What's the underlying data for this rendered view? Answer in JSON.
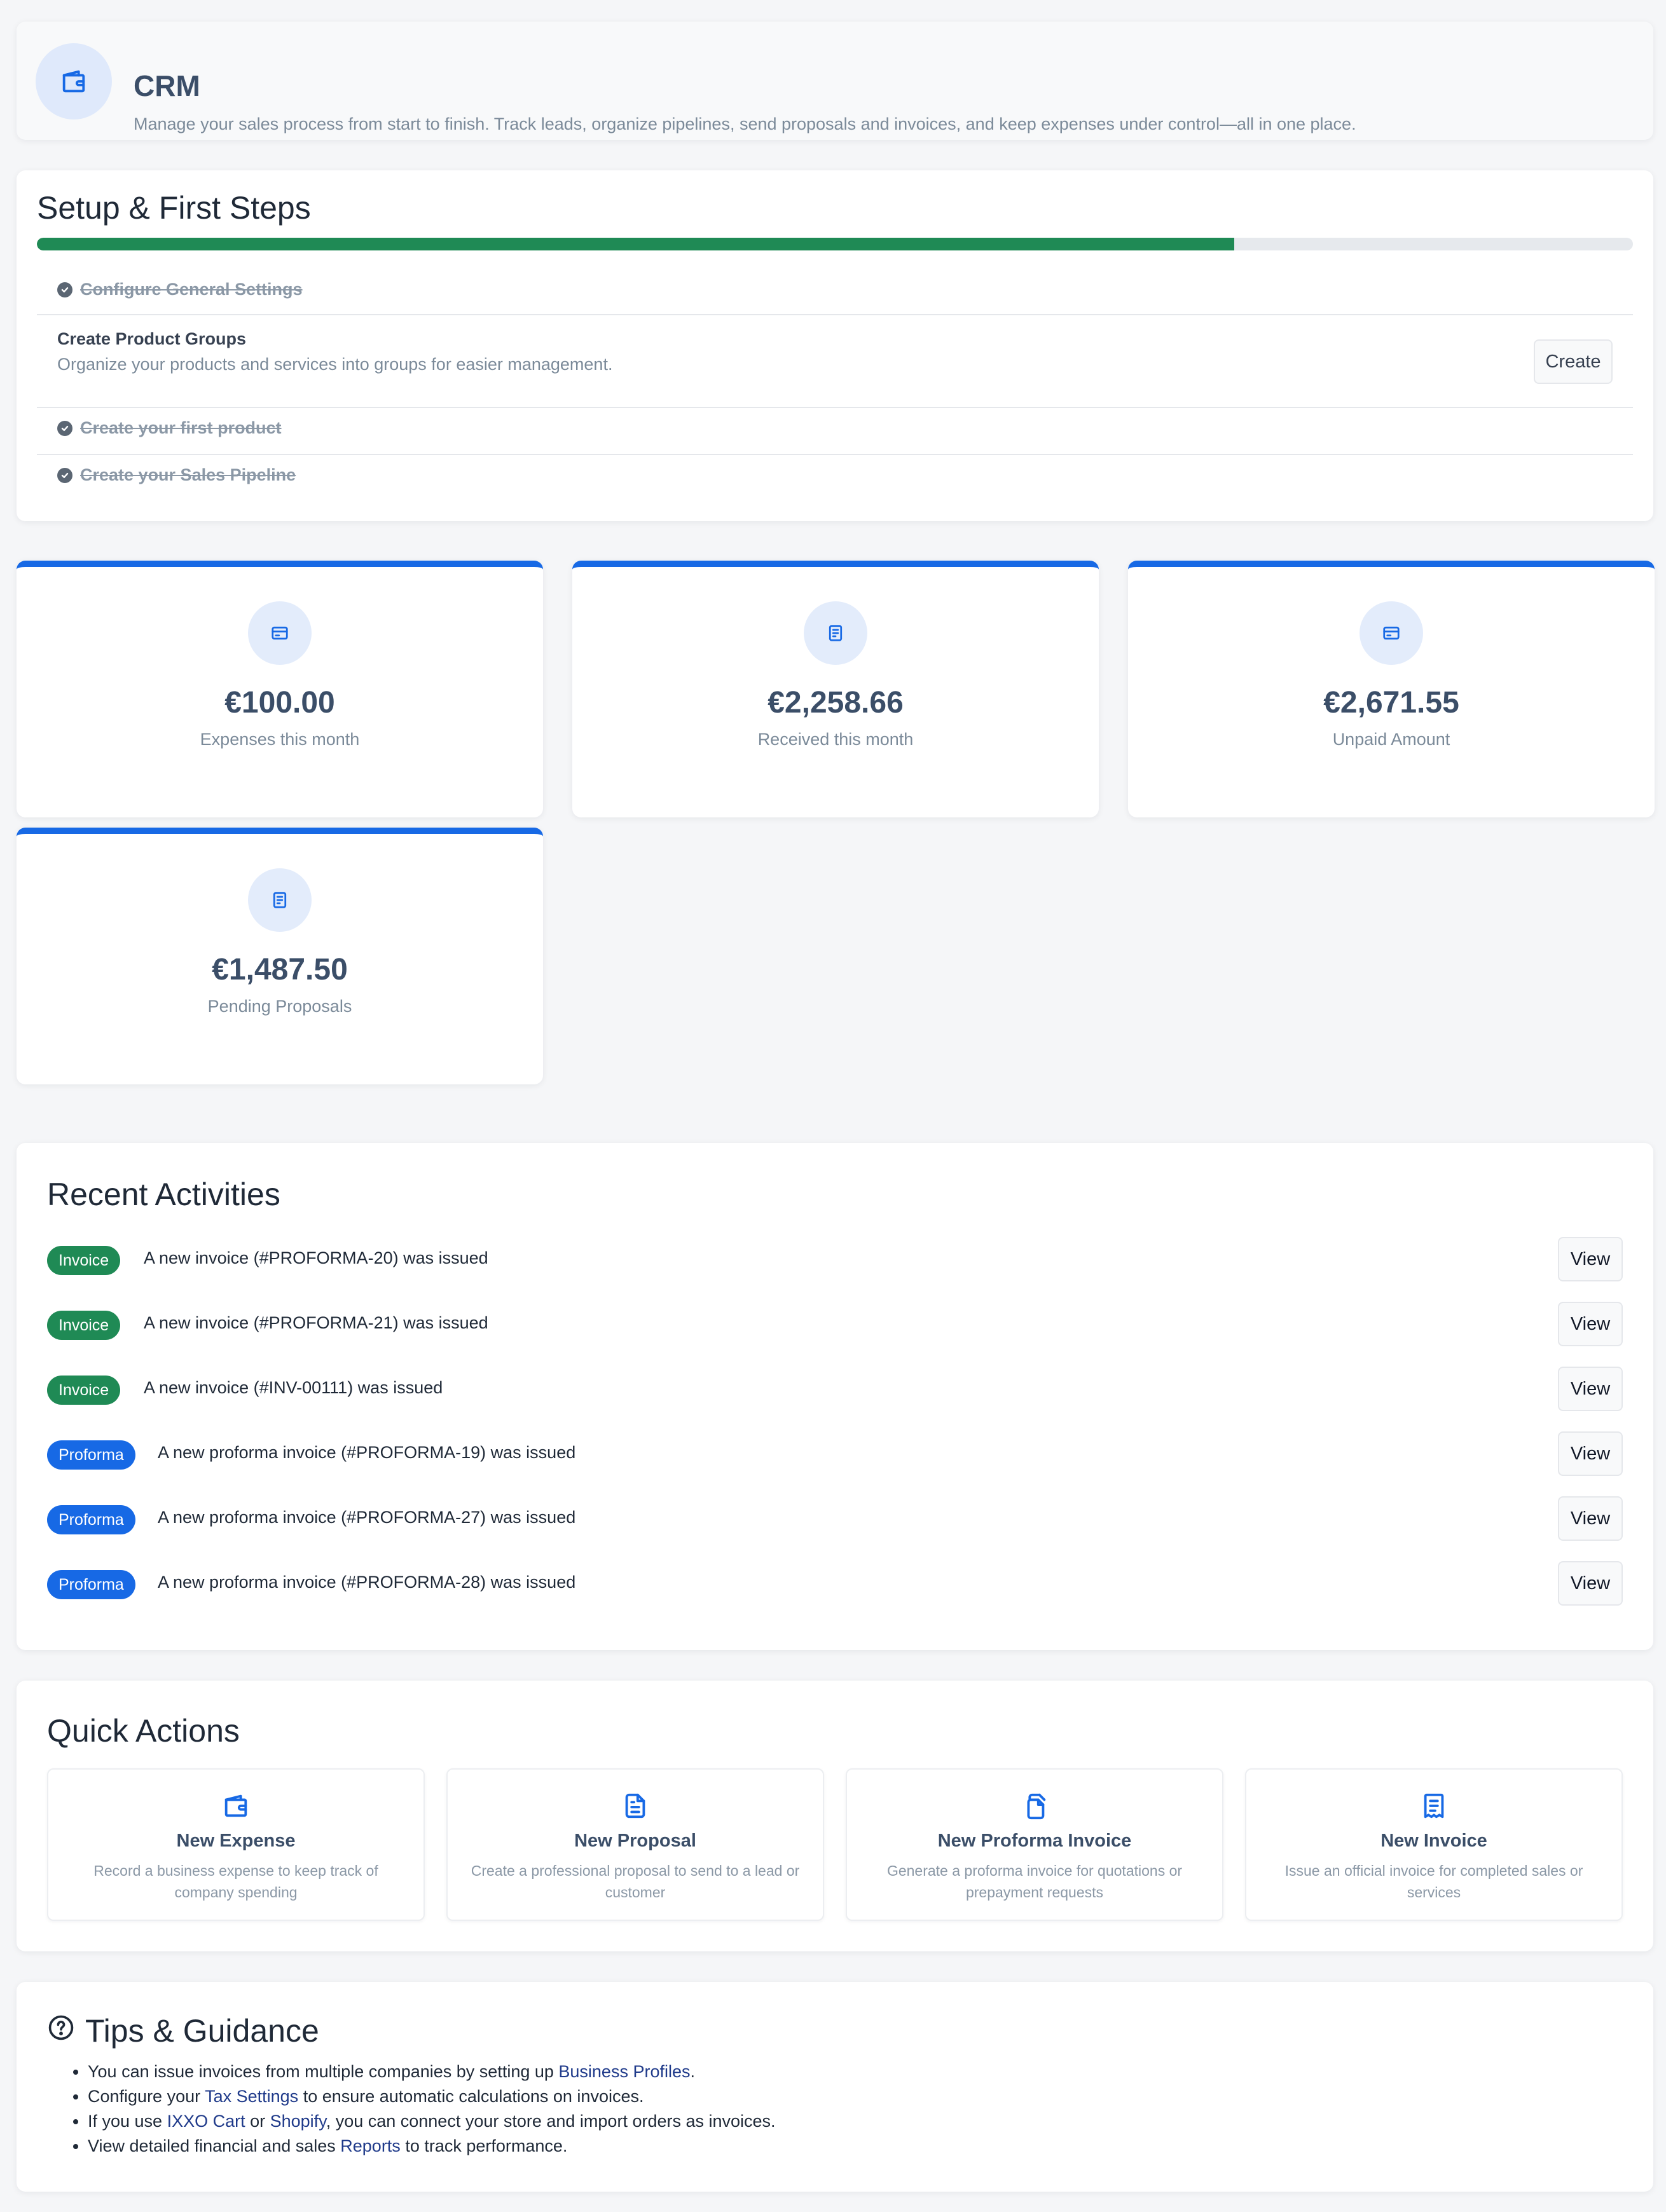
{
  "header": {
    "title": "CRM",
    "subtitle": "Manage your sales process from start to finish. Track leads, organize pipelines, send proposals and invoices, and keep expenses under control—all in one place.",
    "icon": "wallet-icon"
  },
  "setup": {
    "title": "Setup & First Steps",
    "progress": 0.75,
    "steps": [
      {
        "label": "Configure General Settings",
        "done": true
      },
      {
        "label": "Create Product Groups",
        "description": "Organize your products and services into groups for easier management.",
        "done": false,
        "action_label": "Create"
      },
      {
        "label": "Create your first product",
        "done": true
      },
      {
        "label": "Create your Sales Pipeline",
        "done": true
      }
    ]
  },
  "stats": [
    {
      "value": "€100.00",
      "label": "Expenses this month",
      "icon": "credit-card-icon"
    },
    {
      "value": "€2,258.66",
      "label": "Received this month",
      "icon": "document-icon"
    },
    {
      "value": "€2,671.55",
      "label": "Unpaid Amount",
      "icon": "credit-card-icon"
    },
    {
      "value": "€1,487.50",
      "label": "Pending Proposals",
      "icon": "document-icon"
    }
  ],
  "recent": {
    "title": "Recent Activities",
    "view_label": "View",
    "items": [
      {
        "type": "Invoice",
        "text": "A new invoice (#PROFORMA-20) was issued"
      },
      {
        "type": "Invoice",
        "text": "A new invoice (#PROFORMA-21) was issued"
      },
      {
        "type": "Invoice",
        "text": "A new invoice (#INV-00111) was issued"
      },
      {
        "type": "Proforma",
        "text": "A new proforma invoice (#PROFORMA-19) was issued"
      },
      {
        "type": "Proforma",
        "text": "A new proforma invoice (#PROFORMA-27) was issued"
      },
      {
        "type": "Proforma",
        "text": "A new proforma invoice (#PROFORMA-28) was issued"
      }
    ]
  },
  "quick_actions": {
    "title": "Quick Actions",
    "items": [
      {
        "title": "New Expense",
        "description": "Record a business expense to keep track of company spending",
        "icon": "wallet-icon"
      },
      {
        "title": "New Proposal",
        "description": "Create a professional proposal to send to a lead or customer",
        "icon": "file-text-icon"
      },
      {
        "title": "New Proforma Invoice",
        "description": "Generate a proforma invoice for quotations or prepayment requests",
        "icon": "copy-files-icon"
      },
      {
        "title": "New Invoice",
        "description": "Issue an official invoice for completed sales or services",
        "icon": "receipt-icon"
      }
    ]
  },
  "tips": {
    "title": "Tips & Guidance",
    "items": [
      {
        "pre": "You can issue invoices from multiple companies by setting up ",
        "link": "Business Profiles",
        "post": "."
      },
      {
        "pre": "Configure your ",
        "link": "Tax Settings",
        "post": " to ensure automatic calculations on invoices."
      },
      {
        "pre": "If you use ",
        "link": "IXXO Cart",
        "mid": " or ",
        "link2": "Shopify",
        "post": ", you can connect your store and import orders as invoices."
      },
      {
        "pre": "View detailed financial and sales ",
        "link": "Reports",
        "post": " to track performance."
      }
    ]
  },
  "colors": {
    "accent_blue": "#1769e5",
    "success_green": "#1f8a55",
    "heading_slate": "#3b4e68",
    "muted_text": "#7b8a99"
  }
}
